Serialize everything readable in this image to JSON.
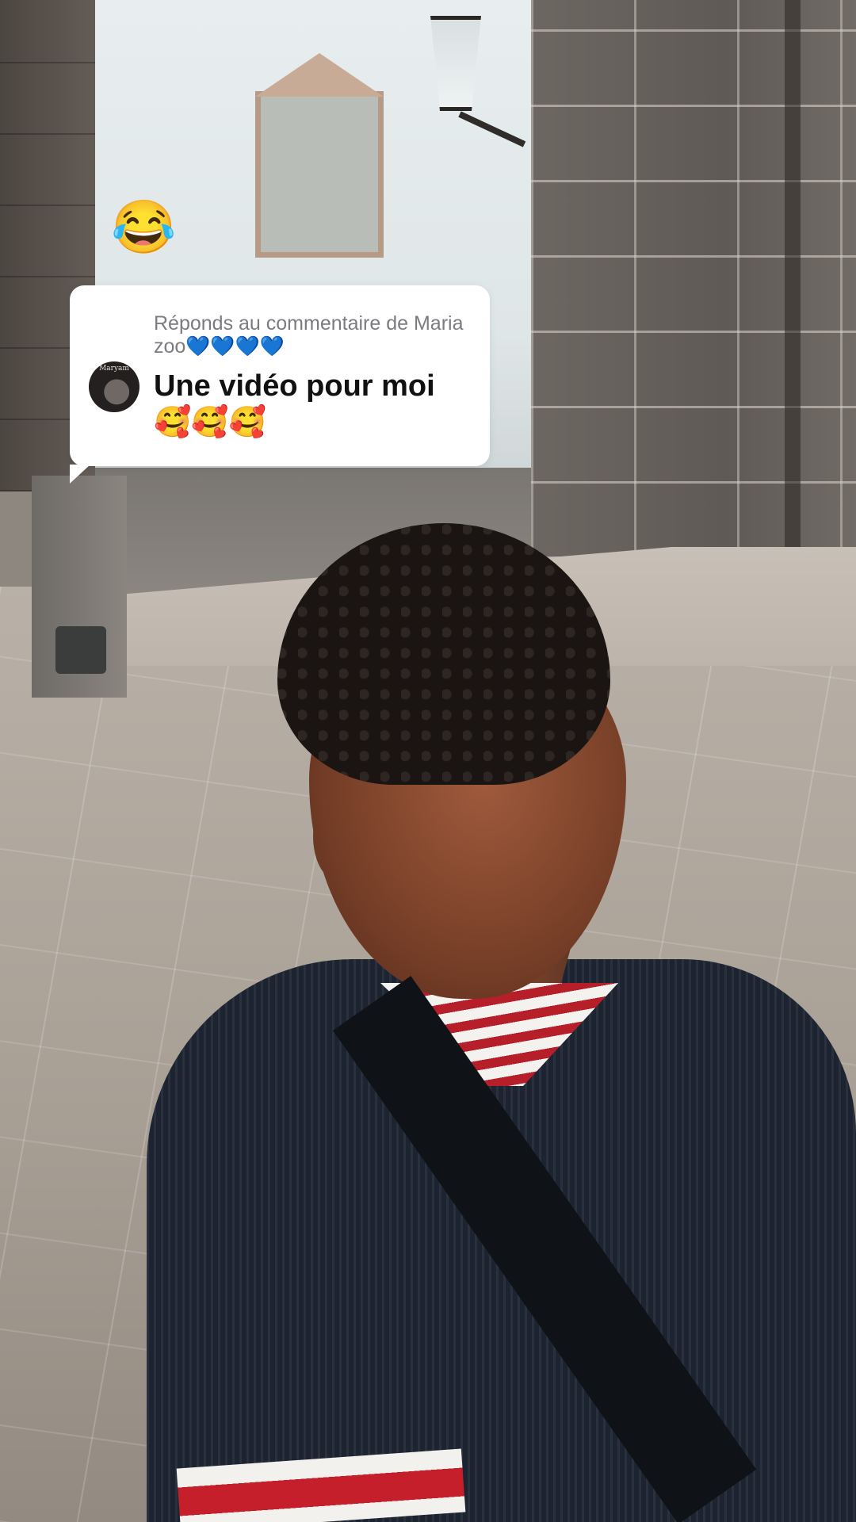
{
  "overlay": {
    "reaction_emoji": "😂"
  },
  "reply_card": {
    "header": "Réponds au commentaire de Maria zoo💙💙💙💙",
    "comment": "Une vidéo pour moi 🥰🥰🥰",
    "avatar": {
      "label": "Maryam",
      "icon": "profile-avatar-image"
    }
  },
  "colors": {
    "card_background": "#ffffff",
    "header_text": "#7b7b80",
    "comment_text": "#111111"
  }
}
